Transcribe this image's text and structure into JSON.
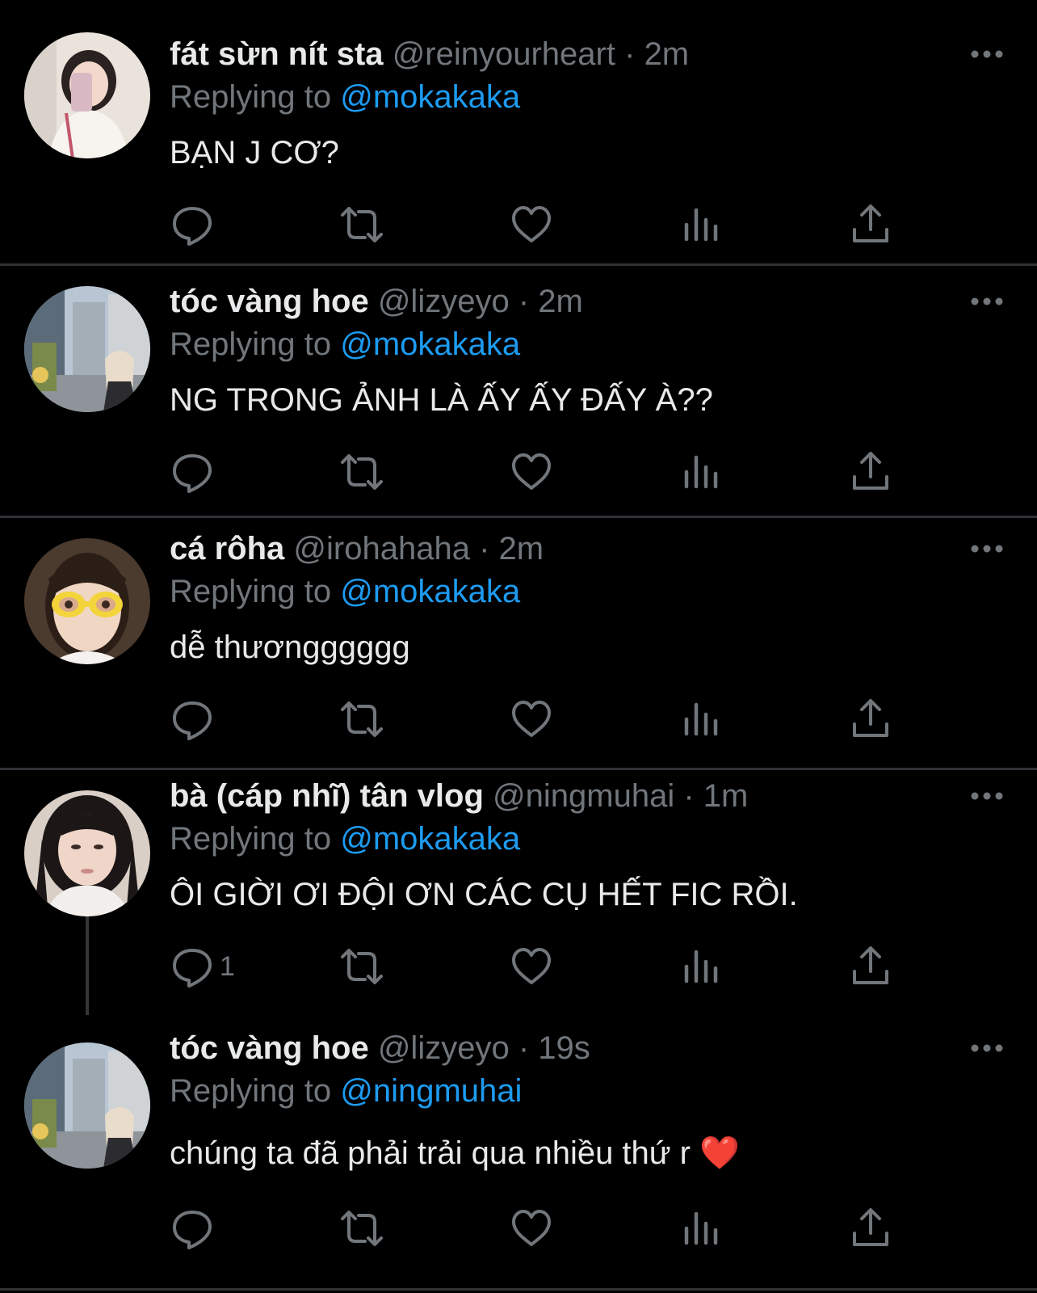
{
  "tweets": [
    {
      "name": "fát sừn nít sta",
      "handle": "@reinyourheart",
      "separator": "·",
      "time": "2m",
      "replying_label": "Replying to ",
      "replying_to": "@mokakaka",
      "text": "BẠN J CƠ?",
      "reply_count": ""
    },
    {
      "name": "tóc vàng hoe",
      "handle": "@lizyeyo",
      "separator": "·",
      "time": "2m",
      "replying_label": "Replying to ",
      "replying_to": "@mokakaka",
      "text": "NG TRONG ẢNH LÀ ẤY ẤY ĐẤY À??",
      "reply_count": ""
    },
    {
      "name": "cá rôha",
      "handle": "@irohahaha",
      "separator": "·",
      "time": "2m",
      "replying_label": "Replying to ",
      "replying_to": "@mokakaka",
      "text": "dễ thươngggggg",
      "reply_count": ""
    },
    {
      "name": "bà (cáp nhĩ) tân vlog",
      "handle": "@ningmuhai",
      "separator": "·",
      "time": "1m",
      "replying_label": "Replying to ",
      "replying_to": "@mokakaka",
      "text": "ÔI GIỜI ƠI ĐỘI ƠN CÁC CỤ HẾT FIC RỒI.",
      "reply_count": "1"
    },
    {
      "name": "tóc vàng hoe",
      "handle": "@lizyeyo",
      "separator": "·",
      "time": "19s",
      "replying_label": "Replying to ",
      "replying_to": "@ningmuhai",
      "text": "chúng ta đã phải trải qua nhiều thứ r ",
      "emoji": "❤️",
      "reply_count": ""
    }
  ],
  "icons": {
    "reply": "reply-icon",
    "retweet": "retweet-icon",
    "like": "heart-icon",
    "views": "views-icon",
    "share": "share-icon",
    "more": "more-icon"
  },
  "colors": {
    "background": "#000000",
    "text": "#e7e9ea",
    "muted": "#71767b",
    "link": "#1d9bf0",
    "divider": "#2f3336"
  }
}
